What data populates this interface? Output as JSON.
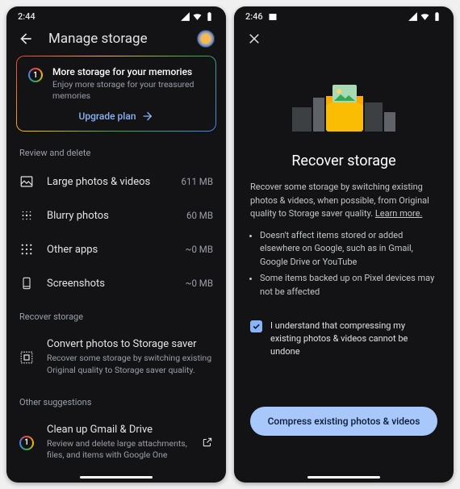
{
  "left": {
    "status_time": "2:44",
    "title": "Manage storage",
    "promo_title": "More storage for your memories",
    "promo_sub": "Enjoy more storage for your treasured memories",
    "upgrade": "Upgrade plan",
    "section_review": "Review and delete",
    "items": [
      {
        "label": "Large photos & videos",
        "value": "611 MB"
      },
      {
        "label": "Blurry photos",
        "value": "60 MB"
      },
      {
        "label": "Other apps",
        "value": "~0 MB"
      },
      {
        "label": "Screenshots",
        "value": "~0 MB"
      }
    ],
    "section_recover": "Recover storage",
    "convert_title": "Convert photos to Storage saver",
    "convert_sub": "Recover some storage by switching existing Original quality to Storage saver quality.",
    "section_other": "Other suggestions",
    "cleanup_title": "Clean up Gmail & Drive",
    "cleanup_sub": "Review and delete large attachments, files, and items with Google One"
  },
  "right": {
    "status_time": "2:46",
    "title": "Recover storage",
    "para": "Recover some storage by switching existing photos & videos, when possible, from Original quality to Storage saver quality. ",
    "learn_more": "Learn more.",
    "bullet1": "Doesn't affect items stored or added elsewhere on Google, such as in Gmail, Google Drive or YouTube",
    "bullet2": "Some items backed up on Pixel devices may not be affected",
    "check_label": "I understand that compressing my existing photos & videos cannot be undone",
    "cta": "Compress existing photos & videos"
  }
}
